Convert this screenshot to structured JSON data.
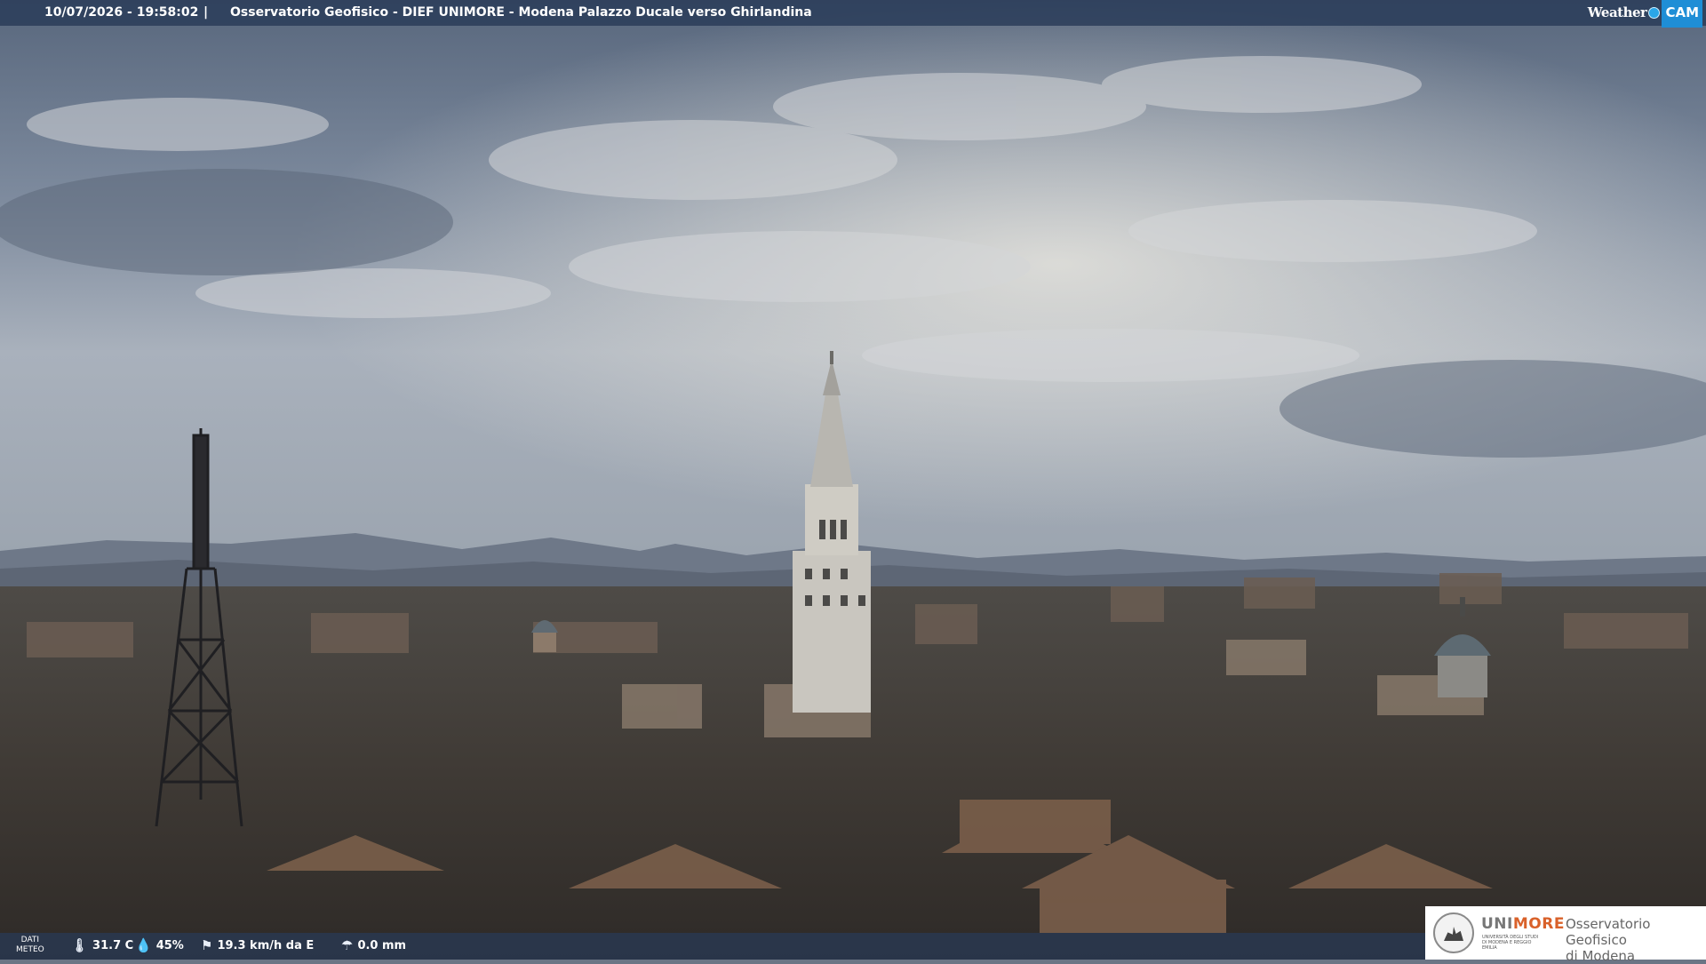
{
  "header": {
    "timestamp": "10/07/2026 - 19:58:02",
    "separator": "|",
    "title": "Osservatorio Geofisico - DIEF UNIMORE - Modena Palazzo Ducale verso Ghirlandina"
  },
  "brand": {
    "weather": "Weather",
    "cam": "CAM"
  },
  "weather": {
    "label_line1": "DATI",
    "label_line2": "METEO",
    "temperature": "31.7 C",
    "humidity": "45%",
    "wind": "19.3 km/h da E",
    "rain": "0.0 mm"
  },
  "logo": {
    "uni_a": "UNI",
    "uni_b": "MORE",
    "uni_sub": "UNIVERSITÀ DEGLI STUDI DI MODENA E REGGIO EMILIA",
    "observatory_line1": "Osservatorio Geofisico",
    "observatory_line2": "di Modena"
  },
  "colors": {
    "bar": "#283a58",
    "brand_blue": "#1f8ed6",
    "unimore_orange": "#d9612a"
  },
  "icons": {
    "temperature": "thermometer-icon",
    "humidity": "humidity-drop-icon",
    "wind": "wind-sock-icon",
    "rain": "rain-umbrella-icon"
  }
}
